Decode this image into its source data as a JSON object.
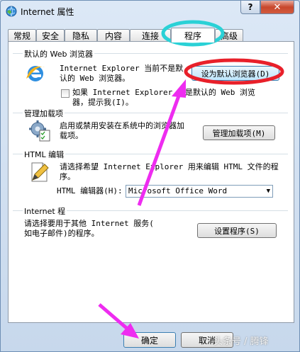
{
  "window": {
    "title": "Internet 属性",
    "help_glyph": "?",
    "close_glyph": "✕"
  },
  "tabs": [
    {
      "label": "常规"
    },
    {
      "label": "安全"
    },
    {
      "label": "隐私"
    },
    {
      "label": "内容"
    },
    {
      "label": "连接"
    },
    {
      "label": "程序",
      "active": true
    },
    {
      "label": "高级"
    }
  ],
  "web_browser": {
    "legend": "默认的 Web 浏览器",
    "text": "Internet Explorer 当前不是默\n认的 Web 浏览器。",
    "set_default_button": "设为默认浏览器(D)",
    "checkbox_label": "如果 Internet Explorer 不是默认的 Web 浏览\n器，提示我(I)。",
    "checkbox_checked": false
  },
  "addons": {
    "legend": "管理加载项",
    "text": "启用或禁用安装在系统中的浏览器加\n载项。",
    "button": "管理加载项(M)"
  },
  "html_editing": {
    "legend": "HTML 编辑",
    "text": "请选择希望 Internet Explorer 用来编辑 HTML 文件的程\n序。",
    "editor_label": "HTML 编辑器(H):",
    "editor_value": "Microsoft Office Word"
  },
  "programs": {
    "legend": "Internet 程",
    "text": "请选择要用于其他 Internet 服务(\n如电子邮件)的程序。",
    "button": "设置程序(S)"
  },
  "footer": {
    "ok": "确定",
    "cancel": "取消"
  },
  "watermark": "头条号 / 腾锋",
  "icons": {
    "app": "globe-icon",
    "browser": "ie-logo-icon",
    "addons": "gear-checklist-icon",
    "html": "document-pen-icon"
  },
  "colors": {
    "annotation_red": "#e8202a",
    "annotation_cyan": "#2ad1d6",
    "annotation_magenta": "#ee2cf0"
  }
}
